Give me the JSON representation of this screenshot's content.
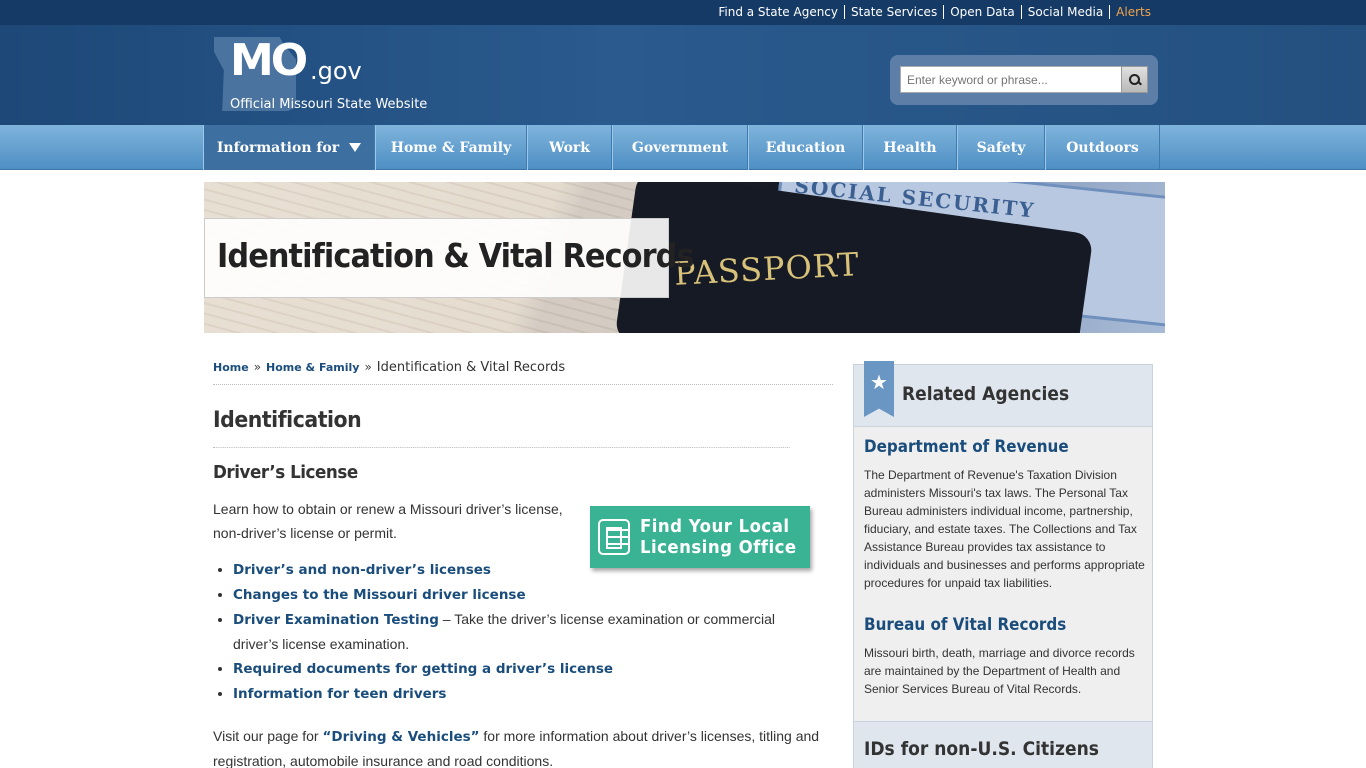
{
  "utility": {
    "links": [
      "Find a State Agency",
      "State Services",
      "Open Data",
      "Social Media",
      "Alerts"
    ]
  },
  "header": {
    "logo_mo": "MO",
    "logo_gov": ".gov",
    "logo_tagline": "Official Missouri State Website",
    "search_placeholder": "Enter keyword or phrase...",
    "search_icon": "magnifier-icon"
  },
  "nav": {
    "items": [
      "Information for",
      "Home & Family",
      "Work",
      "Government",
      "Education",
      "Health",
      "Safety",
      "Outdoors"
    ]
  },
  "banner": {
    "title": "Identification & Vital Records",
    "photo_text_passport": "PASSPORT",
    "photo_text_ss": "SOCIAL SECURITY"
  },
  "breadcrumb": {
    "home": "Home",
    "section": "Home & Family",
    "current": "Identification & Vital Records",
    "separator": "»"
  },
  "main": {
    "heading": "Identification",
    "subheading": "Driver’s License",
    "intro": "Learn how to obtain or renew a Missouri driver’s license, non-driver’s license or permit.",
    "find_button_line1": "Find Your Local",
    "find_button_line2": "Licensing Office",
    "links": [
      {
        "label": "Driver’s and non-driver’s licenses",
        "extra": ""
      },
      {
        "label": "Changes to the Missouri driver license",
        "extra": ""
      },
      {
        "label": "Driver Examination Testing",
        "extra": " – Take the driver’s license examination or commercial driver’s license examination."
      },
      {
        "label": "Required documents for getting a driver’s license",
        "extra": ""
      },
      {
        "label": "Information for teen drivers",
        "extra": ""
      }
    ],
    "visit_prefix": "Visit our page for ",
    "visit_link": "“Driving & Vehicles”",
    "visit_suffix": " for more information about driver’s licenses, titling and registration, automobile insurance and road conditions."
  },
  "sidebar": {
    "title": "Related Agencies",
    "agencies": [
      {
        "name": "Department of Revenue",
        "desc": "The Department of Revenue's Taxation Division administers Missouri's tax laws. The Personal Tax Bureau administers individual income, partnership, fiduciary, and estate taxes. The Collections and Tax Assistance Bureau provides tax assistance to individuals and businesses and performs appropriate procedures for unpaid tax liabilities."
      },
      {
        "name": "Bureau of Vital Records",
        "desc": "Missouri birth, death, marriage and divorce records are maintained by the Department of Health and Senior Services Bureau of Vital Records."
      }
    ],
    "footer_title": "IDs for non-U.S. Citizens"
  },
  "colors": {
    "utility_bg": "#153a66",
    "header_bg": "#23507f",
    "nav_bg": "#5a9bcc",
    "link": "#1a4d7c",
    "alert": "#f0a34b",
    "find_button": "#3ab395"
  }
}
